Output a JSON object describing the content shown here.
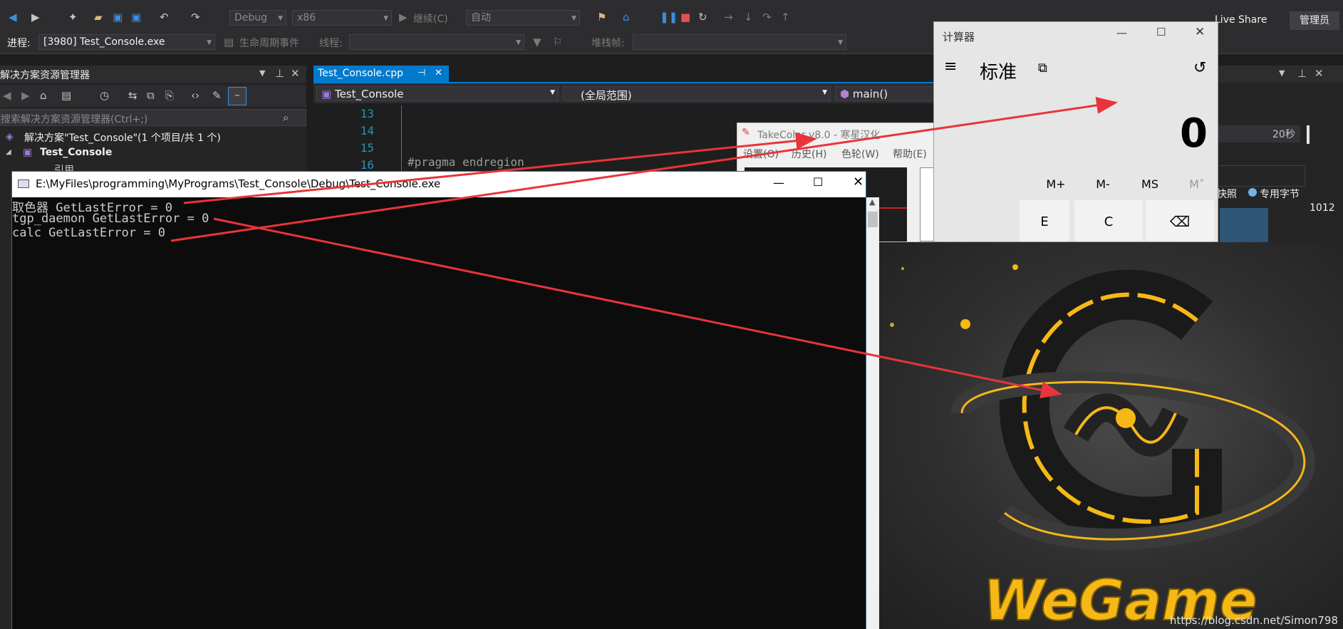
{
  "vs": {
    "toolbar": {
      "config": "Debug",
      "platform": "x86",
      "continue_label": "继续(C)",
      "auto_label": "自动",
      "live_share": "Live Share",
      "admin": "管理员"
    },
    "debug_bar": {
      "process_label": "进程:",
      "process_value": "[3980] Test_Console.exe",
      "lifecycle_label": "生命周期事件",
      "thread_label": "线程:",
      "stack_label": "堆栈帧:"
    },
    "solution_explorer": {
      "title": "解决方案资源管理器",
      "search_placeholder": "搜索解决方案资源管理器(Ctrl+;)",
      "solution_label": "解决方案\"Test_Console\"(1 个项目/共 1 个)",
      "project_label": "Test_Console",
      "ref_label": "引用"
    },
    "editor": {
      "tab_label": "Test_Console.cpp",
      "nav_project": "Test_Console",
      "nav_scope": "(全局范围)",
      "nav_func": "main()",
      "line_numbers": [
        "13",
        "14",
        "15",
        "16"
      ],
      "code_line": "#pragma endregion"
    },
    "right_panel": {
      "time_label": "20秒",
      "snapshot": "快照",
      "private_bytes": "专用字节",
      "value": "1012"
    }
  },
  "console": {
    "title": "E:\\MyFiles\\programming\\MyPrograms\\Test_Console\\Debug\\Test_Console.exe",
    "lines": [
      "取色器 GetLastError = 0",
      "tgp_daemon GetLastError = 0",
      "calc GetLastError = 0"
    ]
  },
  "takecolor": {
    "title": "TakeColor v8.0 - 寒星汉化",
    "menu": [
      "设置(O)",
      "历史(H)",
      "色轮(W)",
      "帮助(E)"
    ]
  },
  "calculator": {
    "title": "计算器",
    "mode": "标准",
    "display": "0",
    "memory_keys": [
      "M+",
      "M-",
      "MS",
      "M˅"
    ],
    "keys": [
      "E",
      "C",
      "⌫"
    ]
  },
  "wegame": {
    "logo_text": "WeGame",
    "watermark": "https://blog.csdn.net/Simon798"
  },
  "colors": {
    "vs_blue": "#007acc",
    "arrow_red": "#e8343a",
    "wegame_gold": "#f5b816"
  }
}
